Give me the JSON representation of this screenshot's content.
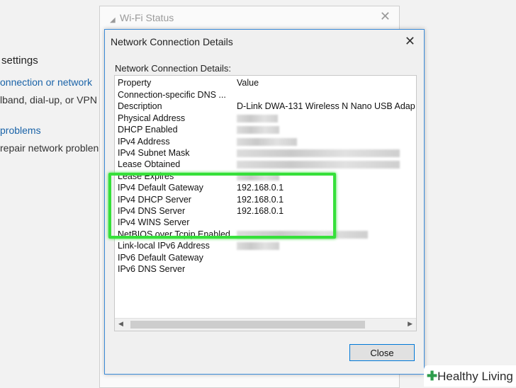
{
  "background": {
    "items": [
      {
        "text": "settings",
        "kind": "heading"
      },
      {
        "text": "onnection or network",
        "kind": "link"
      },
      {
        "text": "lband, dial-up, or VPN",
        "kind": "text"
      },
      {
        "text": "problems",
        "kind": "link"
      },
      {
        "text": "repair network problen",
        "kind": "text"
      }
    ]
  },
  "wifi_window": {
    "title": "Wi-Fi Status",
    "close_glyph": "✕"
  },
  "dialog": {
    "title": "Network Connection Details",
    "close_glyph": "✕",
    "section_label": "Network Connection Details:",
    "columns": {
      "property": "Property",
      "value": "Value"
    },
    "rows": [
      {
        "property": "Connection-specific DNS ...",
        "value": ""
      },
      {
        "property": "Description",
        "value": "D-Link DWA-131 Wireless N Nano USB Adap"
      },
      {
        "property": "Physical Address",
        "value": "",
        "redacted": true
      },
      {
        "property": "DHCP Enabled",
        "value": "",
        "redacted": true
      },
      {
        "property": "IPv4 Address",
        "value": "",
        "redacted": true
      },
      {
        "property": "IPv4 Subnet Mask",
        "value": "",
        "redacted": true
      },
      {
        "property": "Lease Obtained",
        "value": "",
        "redacted": true
      },
      {
        "property": "Lease Expires",
        "value": "",
        "redacted": true
      },
      {
        "property": "IPv4 Default Gateway",
        "value": "192.168.0.1"
      },
      {
        "property": "IPv4 DHCP Server",
        "value": "192.168.0.1"
      },
      {
        "property": "IPv4 DNS Server",
        "value": "192.168.0.1"
      },
      {
        "property": "IPv4 WINS Server",
        "value": ""
      },
      {
        "property": "NetBIOS over Tcpip Enabled",
        "value": "",
        "redacted": true
      },
      {
        "property": "Link-local IPv6 Address",
        "value": "",
        "redacted": true
      },
      {
        "property": "IPv6 Default Gateway",
        "value": ""
      },
      {
        "property": "IPv6 DNS Server",
        "value": ""
      }
    ],
    "close_button": "Close"
  },
  "watermark": {
    "mark": "✚",
    "text": "Healthy Living"
  },
  "colors": {
    "highlight": "#36e03a",
    "accent": "#0078d7",
    "link": "#1a63a8"
  }
}
